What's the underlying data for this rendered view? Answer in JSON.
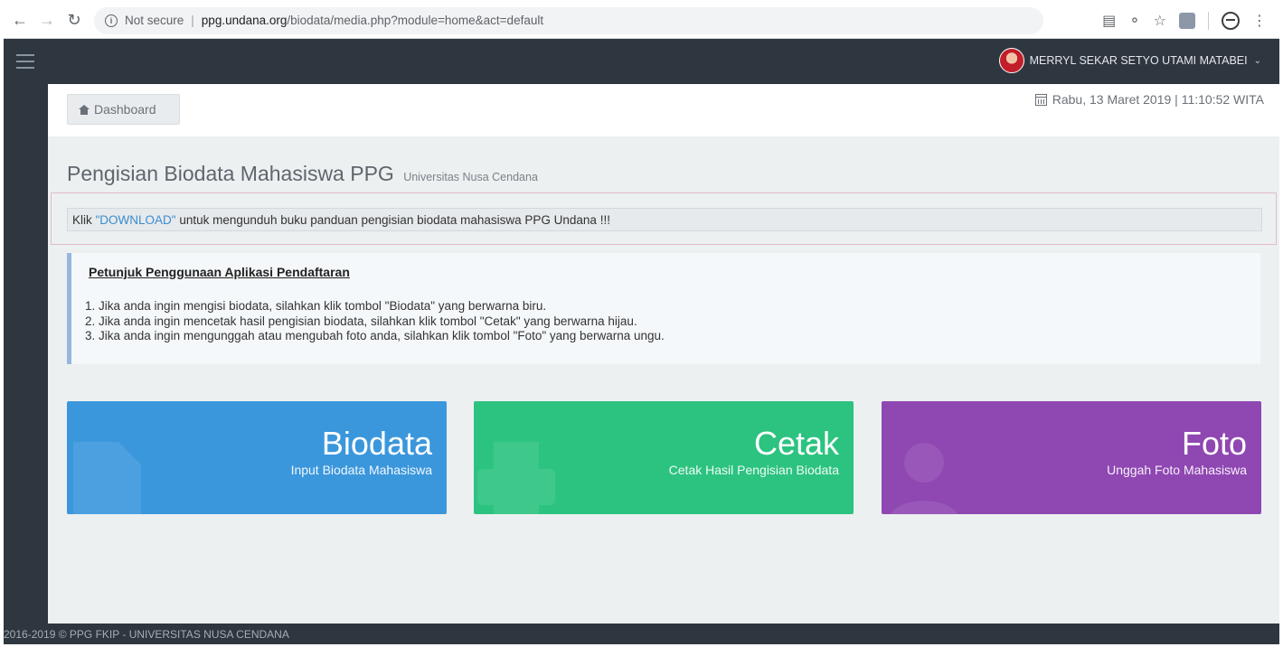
{
  "browser": {
    "security_label": "Not secure",
    "url_host": "ppg.undana.org",
    "url_path": "/biodata/media.php?module=home&act=default"
  },
  "header": {
    "user_name": "MERRYL SEKAR SETYO UTAMI MATABEI"
  },
  "breadcrumb": {
    "label": "Dashboard"
  },
  "datetime": {
    "text": "Rabu, 13 Maret 2019 | 11:10:52 WITA"
  },
  "page": {
    "title": "Pengisian Biodata Mahasiswa PPG",
    "subtitle": "Universitas Nusa Cendana"
  },
  "alert": {
    "prefix": "Klik ",
    "link": "\"DOWNLOAD\"",
    "suffix": " untuk mengunduh buku panduan pengisian biodata mahasiswa PPG Undana !!!"
  },
  "instructions": {
    "title": "Petunjuk Penggunaan Aplikasi Pendaftaran",
    "items": [
      "1. Jika anda ingin mengisi biodata, silahkan klik tombol \"Biodata\" yang berwarna biru.",
      "2. Jika anda ingin mencetak hasil pengisian biodata, silahkan klik tombol \"Cetak\" yang berwarna hijau.",
      "3. Jika anda ingin mengunggah atau mengubah foto anda, silahkan klik tombol \"Foto\" yang berwarna ungu."
    ]
  },
  "tiles": [
    {
      "title": "Biodata",
      "subtitle": "Input Biodata Mahasiswa",
      "color": "#3b97dc",
      "icon": "document-icon"
    },
    {
      "title": "Cetak",
      "subtitle": "Cetak Hasil Pengisian Biodata",
      "color": "#2cc380",
      "icon": "print-icon"
    },
    {
      "title": "Foto",
      "subtitle": "Unggah Foto Mahasiswa",
      "color": "#8f47b2",
      "icon": "user-icon"
    }
  ],
  "footer": {
    "text": "2016-2019 © PPG FKIP - UNIVERSITAS NUSA CENDANA"
  }
}
